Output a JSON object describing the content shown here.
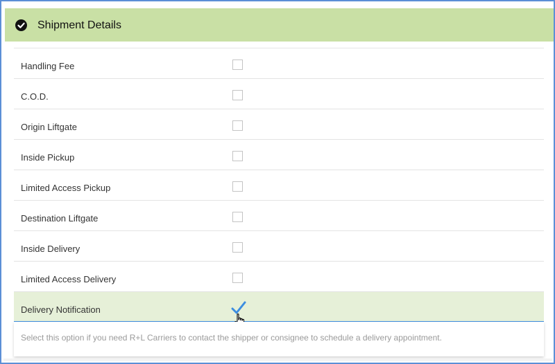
{
  "header": {
    "title": "Shipment Details",
    "icon": "check-circle-icon",
    "background": "#c9e0a5"
  },
  "options": [
    {
      "label": "Handling Fee",
      "checked": false
    },
    {
      "label": "C.O.D.",
      "checked": false
    },
    {
      "label": "Origin Liftgate",
      "checked": false
    },
    {
      "label": "Inside Pickup",
      "checked": false
    },
    {
      "label": "Limited Access Pickup",
      "checked": false
    },
    {
      "label": "Destination Liftgate",
      "checked": false
    },
    {
      "label": "Inside Delivery",
      "checked": false
    },
    {
      "label": "Limited Access Delivery",
      "checked": false
    },
    {
      "label": "Delivery Notification",
      "checked": true
    }
  ],
  "help": {
    "text": "Select this option if you need R+L Carriers to contact the shipper or consignee to schedule a delivery appointment."
  },
  "colors": {
    "accent": "#3c8de0",
    "active_row": "#e6f0d8",
    "frame_border": "#5b8fd6"
  }
}
